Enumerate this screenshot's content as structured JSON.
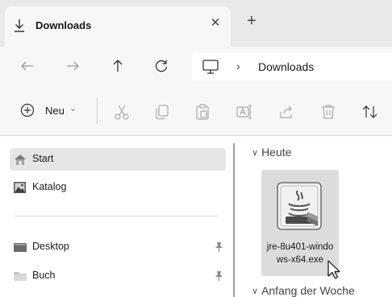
{
  "tab": {
    "title": "Downloads",
    "close": "✕",
    "new_tab": "+"
  },
  "address_bar": {
    "separator": "›",
    "path": "Downloads"
  },
  "command_bar": {
    "new_label": "Neu",
    "new_chevron": "⌄"
  },
  "sidebar": {
    "items": [
      {
        "label": "Start",
        "icon": "home-icon"
      },
      {
        "label": "Katalog",
        "icon": "gallery-icon"
      },
      {
        "label": "Desktop",
        "icon": "desktop-folder-icon",
        "pinned": true
      },
      {
        "label": "Buch",
        "icon": "folder-icon",
        "pinned": true
      }
    ]
  },
  "content": {
    "groups": [
      {
        "label": "Heute"
      },
      {
        "label": "Anfang der Woche"
      }
    ],
    "file": {
      "name": "jre-8u401-windows-x64.exe",
      "icon": "java-installer-icon"
    }
  },
  "colors": {
    "tab_bar_bg": "#e9e9e9",
    "toolbar_bg": "#f7f7f7",
    "selected_item_bg": "#e6e6e6",
    "file_tile_bg": "#dcdcdc"
  }
}
